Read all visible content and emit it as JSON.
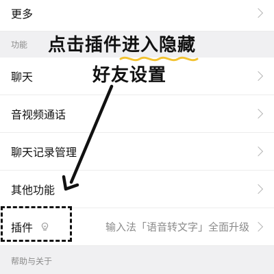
{
  "rows": {
    "more": "更多",
    "chat": "聊天",
    "av_call": "音视频通话",
    "chat_history": "聊天记录管理",
    "other_functions": "其他功能",
    "plugins": "插件",
    "plugins_value": "输入法「语音转文字」全面升级"
  },
  "sections": {
    "functions": "功能",
    "help_about": "帮助与关于"
  },
  "annotation": {
    "line1": "点击插件进入隐藏",
    "line2": "好友设置",
    "highlight_color": "#f2c230"
  },
  "icons": {
    "chevron": "chevron-right-icon",
    "plugin": "plugin-bulb-icon"
  }
}
